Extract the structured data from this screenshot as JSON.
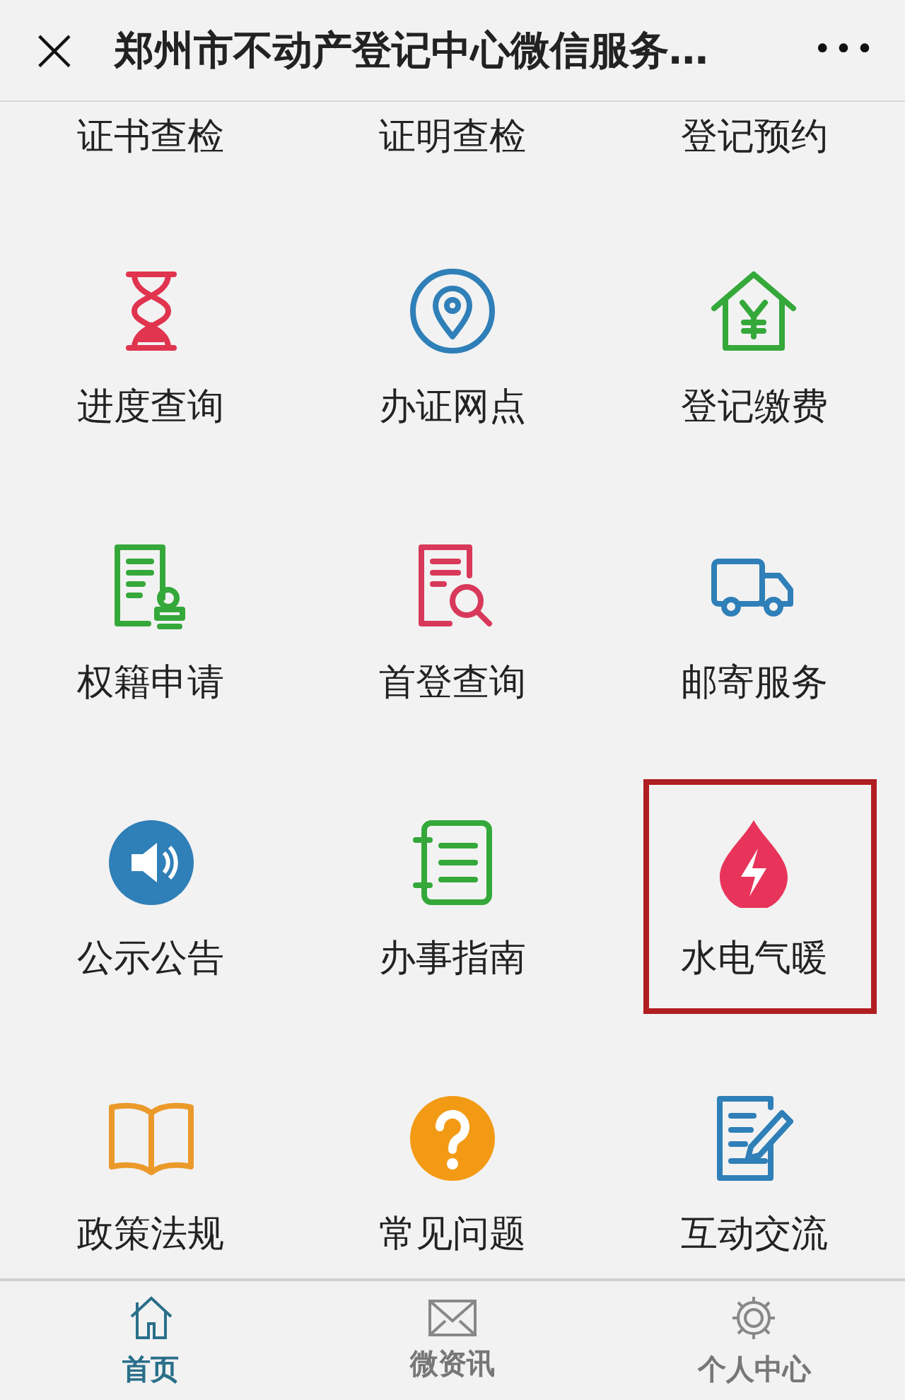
{
  "header": {
    "close": "×",
    "title": "郑州市不动产登记中心微信服务…",
    "more": "•••"
  },
  "top_row": [
    "证书查检",
    "证明查检",
    "登记预约"
  ],
  "tiles": [
    {
      "label": "进度查询",
      "kind": "hourglass",
      "color": "#e0344f",
      "highlighted": false
    },
    {
      "label": "办证网点",
      "kind": "pin",
      "color": "#2f7fb8",
      "highlighted": false
    },
    {
      "label": "登记缴费",
      "kind": "house",
      "color": "#35a83a",
      "highlighted": false
    },
    {
      "label": "权籍申请",
      "kind": "stamp",
      "color": "#35a83a",
      "highlighted": false
    },
    {
      "label": "首登查询",
      "kind": "docsearch",
      "color": "#d8395a",
      "highlighted": false
    },
    {
      "label": "邮寄服务",
      "kind": "truck",
      "color": "#2f7fb8",
      "highlighted": false
    },
    {
      "label": "公示公告",
      "kind": "speaker",
      "color": "#2f7fb8",
      "highlighted": false
    },
    {
      "label": "办事指南",
      "kind": "notebook",
      "color": "#35a83a",
      "highlighted": false
    },
    {
      "label": "水电气暖",
      "kind": "drop",
      "color": "#e8345a",
      "highlighted": true
    },
    {
      "label": "政策法规",
      "kind": "book",
      "color": "#eb9a2a",
      "highlighted": false
    },
    {
      "label": "常见问题",
      "kind": "question",
      "color": "#f39a14",
      "highlighted": false
    },
    {
      "label": "互动交流",
      "kind": "edit",
      "color": "#2f7fb8",
      "highlighted": false
    }
  ],
  "tabbar": [
    {
      "label": "首页",
      "kind": "home",
      "selected": true
    },
    {
      "label": "微资讯",
      "kind": "mail",
      "selected": false
    },
    {
      "label": "个人中心",
      "kind": "gear",
      "selected": false
    }
  ]
}
